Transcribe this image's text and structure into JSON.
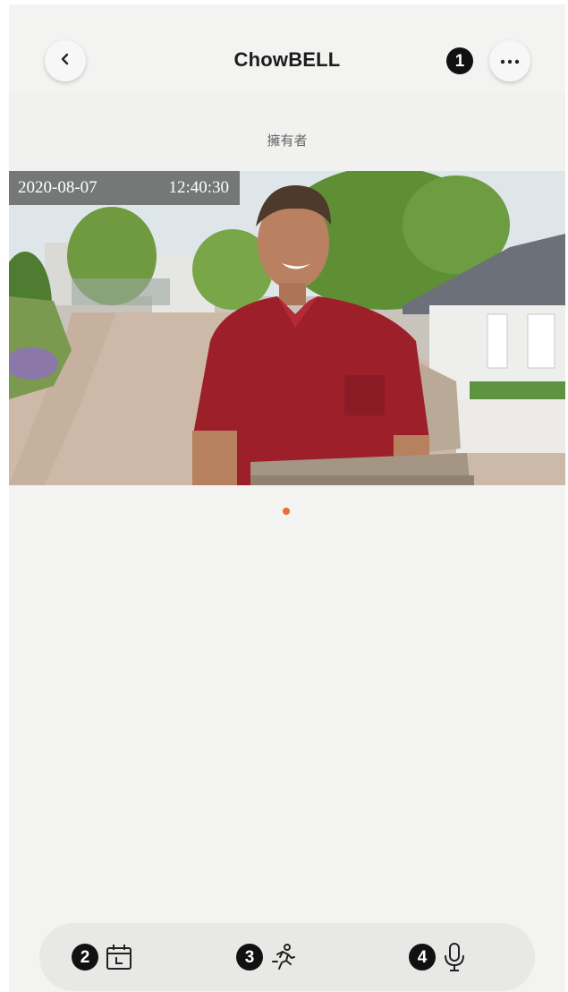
{
  "header": {
    "title": "ChowBELL",
    "back_icon": "chevron-left-icon",
    "more_icon": "more-horizontal-icon",
    "marker": "1"
  },
  "owner_label": "擁有者",
  "video": {
    "date": "2020-08-07",
    "time": "12:40:30",
    "content": "live-camera-image"
  },
  "pager": {
    "active_color": "#e8702a",
    "count": 1,
    "active_index": 0
  },
  "toolbar": {
    "items": [
      {
        "marker": "2",
        "icon": "calendar-icon"
      },
      {
        "marker": "3",
        "icon": "motion-run-icon"
      },
      {
        "marker": "4",
        "icon": "microphone-icon"
      }
    ]
  }
}
